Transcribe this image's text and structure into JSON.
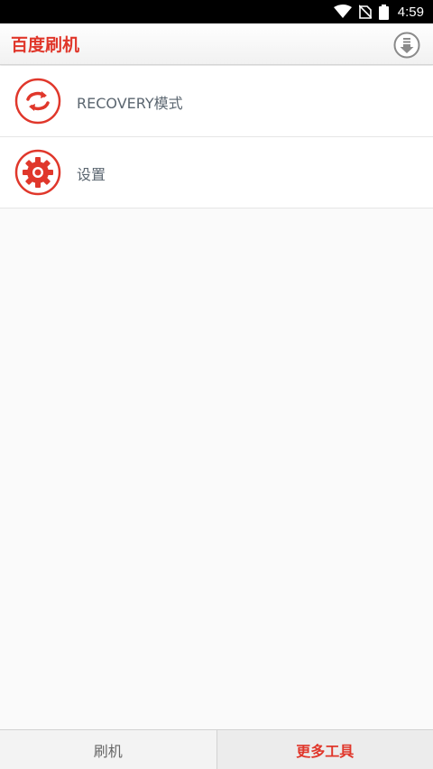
{
  "status_bar": {
    "time": "4:59",
    "icons": [
      "wifi-icon",
      "no-sim-icon",
      "battery-icon"
    ]
  },
  "header": {
    "logo_text": "百度刷机",
    "right_icon": "download-icon"
  },
  "menu": {
    "items": [
      {
        "label": "RECOVERY模式",
        "icon": "refresh-icon"
      },
      {
        "label": "设置",
        "icon": "gear-icon"
      }
    ]
  },
  "bottom_tabs": {
    "tabs": [
      {
        "label": "刷机",
        "selected": false
      },
      {
        "label": "更多工具",
        "selected": true
      }
    ]
  },
  "colors": {
    "accent": "#e0372b",
    "label": "#5b6670",
    "status_bar_bg": "#000000"
  }
}
